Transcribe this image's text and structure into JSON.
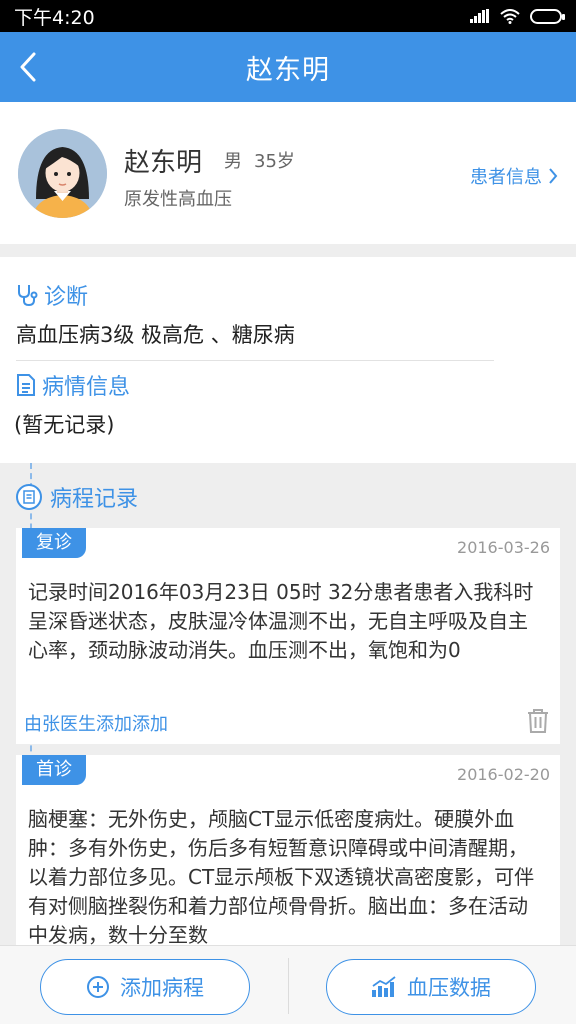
{
  "status_bar": {
    "time": "下午4:20"
  },
  "nav": {
    "title": "赵东明"
  },
  "profile": {
    "name": "赵东明",
    "gender": "男",
    "age": "35岁",
    "diagnosis": "原发性高血压",
    "info_link": "患者信息"
  },
  "diagnosis_section": {
    "title": "诊断",
    "value": "高血压病3级 极高危 、糖尿病"
  },
  "condition_section": {
    "title": "病情信息",
    "value": "(暂无记录)"
  },
  "records": {
    "title": "病程记录",
    "items": [
      {
        "tag": "复诊",
        "date": "2016-03-26",
        "content": "记录时间2016年03月23日 05时 32分患者患者入我科时呈深昏迷状态，皮肤湿冷体温测不出，无自主呼吸及自主心率，颈动脉波动消失。血压测不出，氧饱和为0",
        "added_by": "由张医生添加添加"
      },
      {
        "tag": "首诊",
        "date": "2016-02-20",
        "content": "脑梗塞：无外伤史，颅脑CT显示低密度病灶。硬膜外血肿：多有外伤史，伤后多有短暂意识障碍或中间清醒期，以着力部位多见。CT显示颅板下双透镜状高密度影，可伴有对侧脑挫裂伤和着力部位颅骨骨折。脑出血：多在活动中发病，数十分至数"
      }
    ]
  },
  "bottom": {
    "add_label": "添加病程",
    "bp_label": "血压数据"
  },
  "colors": {
    "accent": "#3e92e6",
    "status_bar": "#000000"
  }
}
